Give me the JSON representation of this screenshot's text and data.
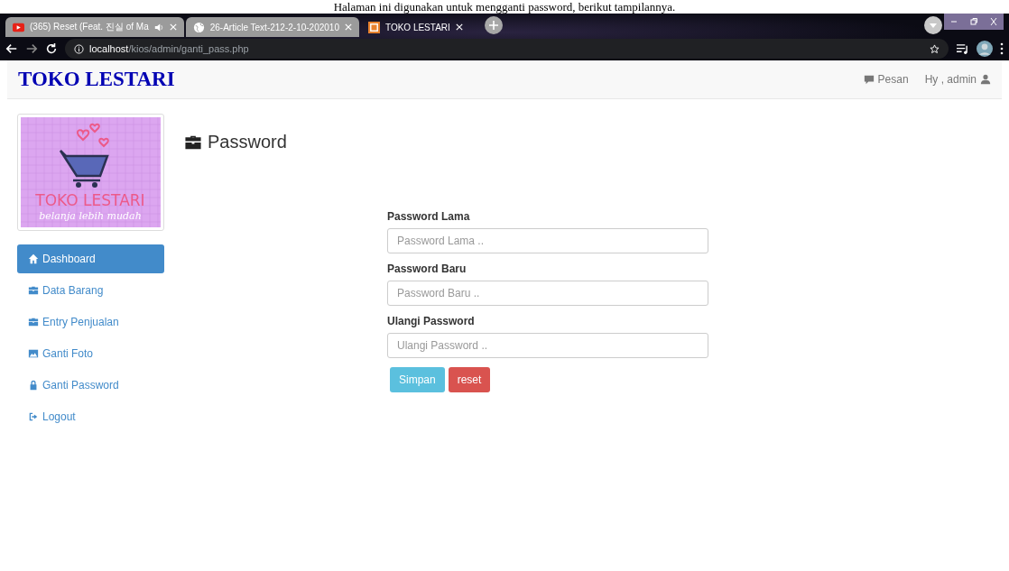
{
  "caption": "Halaman ini digunakan untuk mengganti password, berikut tampilannya.",
  "browser": {
    "tabs": [
      {
        "title": "(365) Reset (Feat. 진실 of Ma",
        "selected": false
      },
      {
        "title": "26-Article Text-212-2-10-202010",
        "selected": false
      },
      {
        "title": "TOKO LESTARI",
        "selected": true
      }
    ],
    "address": {
      "host": "localhost",
      "path": "/kios/admin/ganti_pass.php"
    }
  },
  "navbar": {
    "brand": "TOKO LESTARI",
    "links": [
      {
        "label": "Pesan"
      },
      {
        "label": "Hy , admin"
      }
    ]
  },
  "logo": {
    "title": "TOKO LESTARI",
    "tagline": "belanja lebih mudah"
  },
  "sidebar": {
    "items": [
      {
        "label": "Dashboard",
        "selected": true
      },
      {
        "label": "Data Barang",
        "selected": false
      },
      {
        "label": "Entry Penjualan",
        "selected": false
      },
      {
        "label": "Ganti Foto",
        "selected": false
      },
      {
        "label": "Ganti Password",
        "selected": false
      },
      {
        "label": "Logout",
        "selected": false
      }
    ]
  },
  "page": {
    "heading": "Password",
    "fields": [
      {
        "label": "Password Lama",
        "placeholder": "Password Lama .."
      },
      {
        "label": "Password Baru",
        "placeholder": "Password Baru .."
      },
      {
        "label": "Ulangi Password",
        "placeholder": "Ulangi Password .."
      }
    ],
    "buttons": [
      {
        "label": "Simpan",
        "kind": "info"
      },
      {
        "label": "reset",
        "kind": "danger"
      }
    ]
  }
}
